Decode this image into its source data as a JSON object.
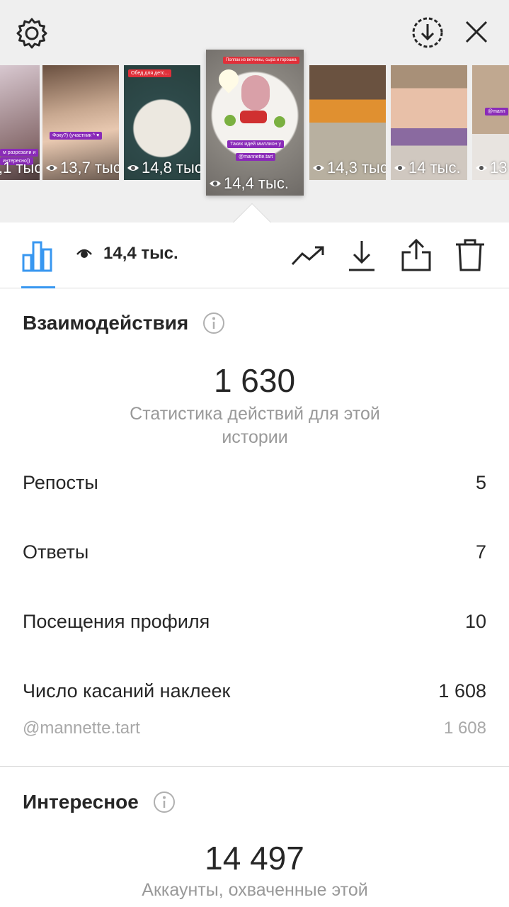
{
  "header": {
    "icons": [
      "gear-icon",
      "download-circle-icon",
      "close-icon"
    ]
  },
  "stories": [
    {
      "views": ",1 тыс.",
      "stickers": [
        "м разрезали и",
        "интересно))"
      ]
    },
    {
      "views": "13,7 тыс.",
      "stickers": [
        "Фоку?) (участник ^ ♥"
      ]
    },
    {
      "views": "14,8 тыс.",
      "stickers": [
        "Обед для детс..."
      ]
    },
    {
      "views": "14,4 тыс.",
      "stickers": [
        "Полпак из ветчины, сыра и горошка",
        "Таких идей миллион у",
        "@mannette.tart"
      ],
      "active": true
    },
    {
      "views": "14,3 тыс.",
      "stickers": []
    },
    {
      "views": "14 тыс.",
      "stickers": []
    },
    {
      "views": "13",
      "stickers": [
        "@mann"
      ]
    }
  ],
  "toolbar": {
    "views": "14,4 тыс.",
    "icons": [
      "bar-chart-icon",
      "eye-icon",
      "trend-icon",
      "download-icon",
      "share-icon",
      "trash-icon"
    ]
  },
  "interactions": {
    "title": "Взаимодействия",
    "total": "1 630",
    "subtitle": "Статистика действий для этой истории",
    "rows": [
      {
        "label": "Репосты",
        "value": "5"
      },
      {
        "label": "Ответы",
        "value": "7"
      },
      {
        "label": "Посещения профиля",
        "value": "10"
      },
      {
        "label": "Число касаний наклеек",
        "value": "1 608"
      }
    ],
    "sub_row": {
      "label": "@mannette.tart",
      "value": "1 608"
    }
  },
  "discovery": {
    "title": "Интересное",
    "total": "14 497",
    "subtitle": "Аккаунты, охваченные этой"
  },
  "colors": {
    "accent": "#3897f0",
    "text": "#262626",
    "muted": "#999999",
    "sticker_red": "#e0303a",
    "sticker_purple": "#8a2bb8"
  }
}
